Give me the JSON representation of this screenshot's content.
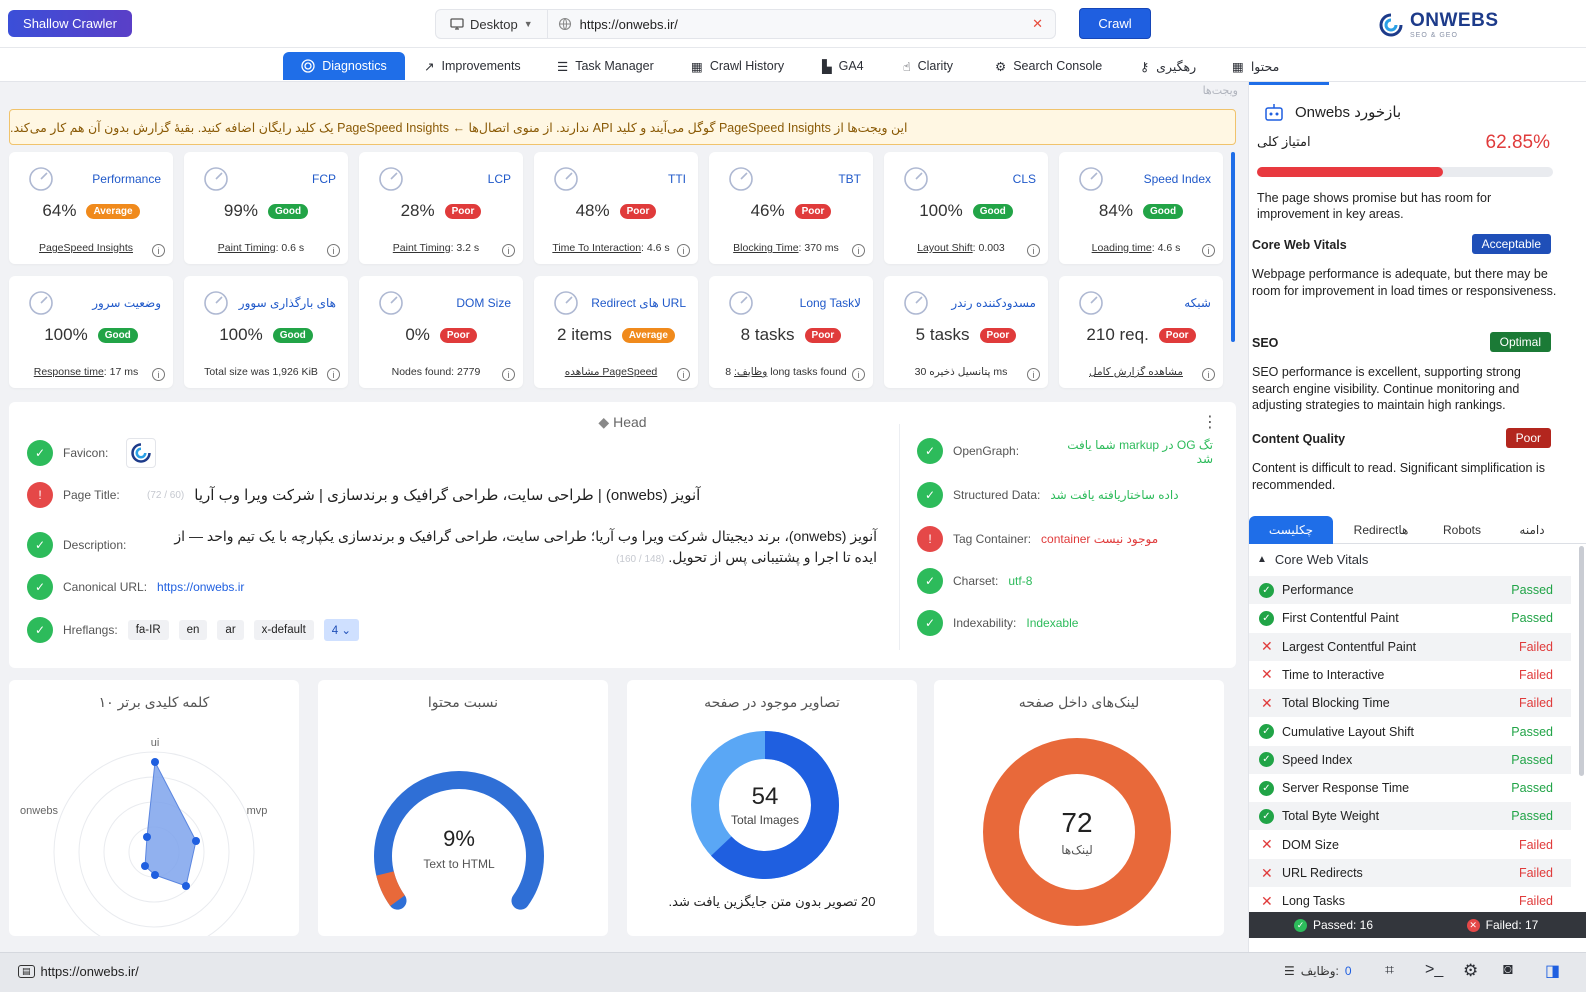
{
  "topbar": {
    "app_button": "Shallow Crawler",
    "device": "Desktop",
    "url": "https://onwebs.ir/",
    "crawl_label": "Crawl",
    "logo_text": "ONWEBS",
    "logo_sub": "SEO & GEO"
  },
  "nav": [
    "Diagnostics",
    "Improvements",
    "Task Manager",
    "Crawl History",
    "GA4",
    "Clarity",
    "Search Console",
    "رهگیری",
    "محتوا"
  ],
  "widgets_label": "ویجت‌ها",
  "banner": "این ویجت‌ها از PageSpeed Insights گوگل می‌آیند و کلید API ندارند. از منوی اتصال‌ها ← PageSpeed Insights یک کلید رایگان اضافه کنید. بقیهٔ گزارش بدون آن هم کار می‌کند.",
  "cards_row1": [
    {
      "title": "Performance",
      "value": "64%",
      "badge": "Average",
      "sub_link": "PageSpeed Insights",
      "sub_rest": ""
    },
    {
      "title": "FCP",
      "value": "99%",
      "badge": "Good",
      "sub_link": "Paint Timing",
      "sub_rest": ": 0.6 s"
    },
    {
      "title": "LCP",
      "value": "28%",
      "badge": "Poor",
      "sub_link": "Paint Timing",
      "sub_rest": ": 3.2 s"
    },
    {
      "title": "TTI",
      "value": "48%",
      "badge": "Poor",
      "sub_link": "Time To Interaction",
      "sub_rest": ": 4.6 s"
    },
    {
      "title": "TBT",
      "value": "46%",
      "badge": "Poor",
      "sub_link": "Blocking Time",
      "sub_rest": ": 370 ms"
    },
    {
      "title": "CLS",
      "value": "100%",
      "badge": "Good",
      "sub_link": "Layout Shift",
      "sub_rest": ": 0.003"
    },
    {
      "title": "Speed Index",
      "value": "84%",
      "badge": "Good",
      "sub_link": "Loading time",
      "sub_rest": ": 4.6 s"
    }
  ],
  "cards_row2": [
    {
      "title": "وضعیت سرور",
      "value": "100%",
      "badge": "Good",
      "sub_link": "Response time",
      "sub_rest": ": 17 ms"
    },
    {
      "title": "های بارگذاری سوور",
      "value": "100%",
      "badge": "Good",
      "sub_link": "",
      "sub_rest": "Total size was 1,926 KiB"
    },
    {
      "title": "DOM Size",
      "value": "0%",
      "badge": "Poor",
      "sub_link": "",
      "sub_rest": "Nodes found: 2779"
    },
    {
      "title": "Redirect های URL",
      "value": "2 items",
      "badge": "Average",
      "sub_link": "مشاهده PageSpeed",
      "sub_rest": ""
    },
    {
      "title": "Long Taskلا",
      "value": "8 tasks",
      "badge": "Poor",
      "sub_link": "وظایف:",
      "sub_rest": " 8 long tasks found"
    },
    {
      "title": "مسدودکننده رندر",
      "value": "5 tasks",
      "badge": "Poor",
      "sub_link": "",
      "sub_rest": "پتانسیل ذخیره 30 ms"
    },
    {
      "title": "شبکه",
      "value": "210 req.",
      "badge": "Poor",
      "sub_link": "مشاهده گزارش کامل",
      "sub_rest": ""
    }
  ],
  "head": {
    "title": "Head",
    "favicon_label": "Favicon:",
    "page_title_label": "Page Title:",
    "page_title": "آنویز (onwebs) | طراحی سایت، طراحی گرافیک و برندسازی | شرکت ویرا وب آریا",
    "page_title_count": "(72 / 60)",
    "description_label": "Description:",
    "description_line1": "آنویز (onwebs)، برند دیجیتال شرکت ویرا وب آریا؛ طراحی سایت، طراحی گرافیک و برندسازی یکپارچه با یک تیم واحد — از",
    "description_line2": "ایده تا اجرا و پشتیبانی پس از تحویل.",
    "description_count": "(148 / 160)",
    "canonical_label": "Canonical URL:",
    "canonical": "https://onwebs.ir",
    "hreflang_label": "Hreflangs:",
    "hreflangs": [
      "fa-IR",
      "en",
      "ar",
      "x-default"
    ],
    "hreflang_count": "4",
    "opengraph_label": "OpenGraph:",
    "opengraph": "تگ OG در markup شما یافت شد",
    "structured_label": "Structured Data:",
    "structured": "داده ساختاریافته یافت شد",
    "tag_label": "Tag Container:",
    "tag": "موجود نیست container",
    "charset_label": "Charset:",
    "charset": "utf-8",
    "index_label": "Indexability:",
    "index": "Indexable"
  },
  "bottom": {
    "keywords_title": "۱۰ کلمه کلیدی برتر",
    "radar_labels": [
      "ui",
      "mvp",
      "onwebs"
    ],
    "ratio_title": "نسبت محتوا",
    "ratio_value": "9%",
    "ratio_label": "Text to HTML",
    "ratio_fraction": 0.09,
    "images_title": "تصاویر موجود در صفحه",
    "images_total": "54",
    "images_label": "Total Images",
    "images_note": "20 تصویر بدون متن جایگزین یافت شد.",
    "images_without_alt": 20,
    "links_title": "لینک‌های داخل صفحه",
    "links_total": "72",
    "links_label": "لینک‌ها"
  },
  "right": {
    "title": "بازخورد Onwebs",
    "score_label": "امتیاز کلی",
    "score": "62.85%",
    "score_fraction": 0.6285,
    "score_text": "The page shows promise but has room for improvement in key areas.",
    "sections": [
      {
        "name": "Core Web Vitals",
        "badge": "Acceptable",
        "color": "#1f4fb8",
        "text": "Webpage performance is adequate, but there may be room for improvement in load times or responsiveness."
      },
      {
        "name": "SEO",
        "badge": "Optimal",
        "color": "#1b7a36",
        "text": "SEO performance is excellent, supporting strong search engine visibility. Continue monitoring and adjusting strategies to maintain high rankings."
      },
      {
        "name": "Content Quality",
        "badge": "Poor",
        "color": "#b3261e",
        "text": "Content is difficult to read. Significant simplification is recommended."
      }
    ],
    "tabs": [
      "چکلیست",
      "Redirectها",
      "Robots",
      "دامنه"
    ],
    "group": "Core Web Vitals",
    "checklist": [
      {
        "name": "Performance",
        "status": "Passed"
      },
      {
        "name": "First Contentful Paint",
        "status": "Passed"
      },
      {
        "name": "Largest Contentful Paint",
        "status": "Failed"
      },
      {
        "name": "Time to Interactive",
        "status": "Failed"
      },
      {
        "name": "Total Blocking Time",
        "status": "Failed"
      },
      {
        "name": "Cumulative Layout Shift",
        "status": "Passed"
      },
      {
        "name": "Speed Index",
        "status": "Passed"
      },
      {
        "name": "Server Response Time",
        "status": "Passed"
      },
      {
        "name": "Total Byte Weight",
        "status": "Passed"
      },
      {
        "name": "DOM Size",
        "status": "Failed"
      },
      {
        "name": "URL Redirects",
        "status": "Failed"
      },
      {
        "name": "Long Tasks",
        "status": "Failed"
      }
    ],
    "passed": "Passed: 16",
    "failed": "Failed: 17"
  },
  "status": {
    "url": "https://onwebs.ir/",
    "tasks_label": "وظایف:",
    "tasks_count": "0"
  }
}
